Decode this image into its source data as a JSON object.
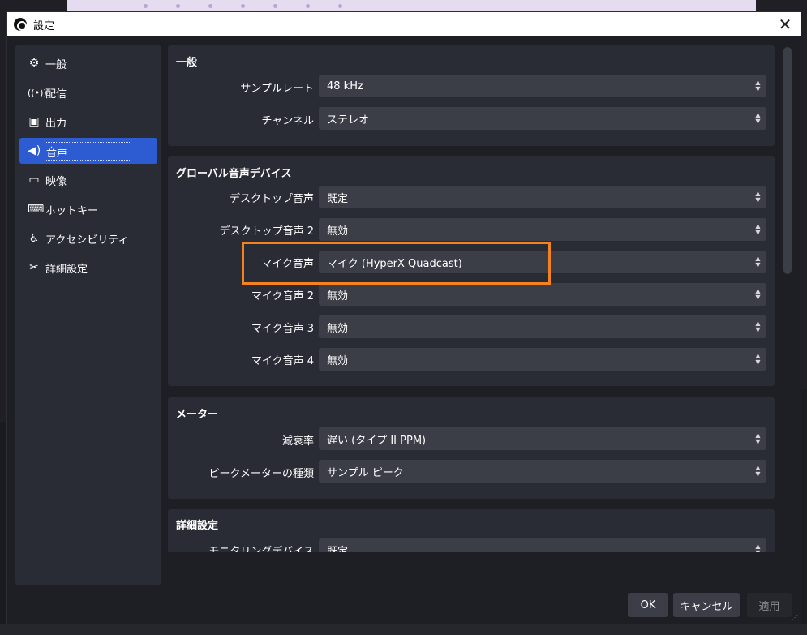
{
  "window": {
    "title": "設定",
    "close_symbol": "✕"
  },
  "sidebar": {
    "items": [
      {
        "label": "一般",
        "icon": "gear-icon",
        "glyph": "⚙"
      },
      {
        "label": "配信",
        "icon": "broadcast-icon",
        "glyph": "📶"
      },
      {
        "label": "出力",
        "icon": "output-icon",
        "glyph": "▣"
      },
      {
        "label": "音声",
        "icon": "speaker-icon",
        "glyph": "🔊"
      },
      {
        "label": "映像",
        "icon": "monitor-icon",
        "glyph": "▭"
      },
      {
        "label": "ホットキー",
        "icon": "keyboard-icon",
        "glyph": "⌨"
      },
      {
        "label": "アクセシビリティ",
        "icon": "accessibility-icon",
        "glyph": "♿"
      },
      {
        "label": "詳細設定",
        "icon": "tools-icon",
        "glyph": "✂"
      }
    ],
    "active": "音声"
  },
  "general": {
    "title": "一般",
    "rows": [
      {
        "label": "サンプルレート",
        "value": "48 kHz"
      },
      {
        "label": "チャンネル",
        "value": "ステレオ"
      }
    ]
  },
  "global_devices": {
    "title": "グローバル音声デバイス",
    "rows": [
      {
        "label": "デスクトップ音声",
        "value": "既定"
      },
      {
        "label": "デスクトップ音声 2",
        "value": "無効"
      },
      {
        "label": "マイク音声",
        "value": "マイク (HyperX Quadcast)"
      },
      {
        "label": "マイク音声 2",
        "value": "無効"
      },
      {
        "label": "マイク音声 3",
        "value": "無効"
      },
      {
        "label": "マイク音声 4",
        "value": "無効"
      }
    ]
  },
  "meters": {
    "title": "メーター",
    "rows": [
      {
        "label": "減衰率",
        "value": "遅い (タイプ II PPM)"
      },
      {
        "label": "ピークメーターの種類",
        "value": "サンプル ピーク"
      }
    ]
  },
  "advanced": {
    "title": "詳細設定",
    "rows": [
      {
        "label": "モニタリングデバイス",
        "value": "既定"
      }
    ]
  },
  "buttons": {
    "ok": "OK",
    "cancel": "キャンセル",
    "apply": "適用"
  },
  "colors": {
    "accent": "#2d5bd1",
    "highlight": "#f58220",
    "panel": "#2a2c35",
    "combo": "#3b3d47"
  }
}
